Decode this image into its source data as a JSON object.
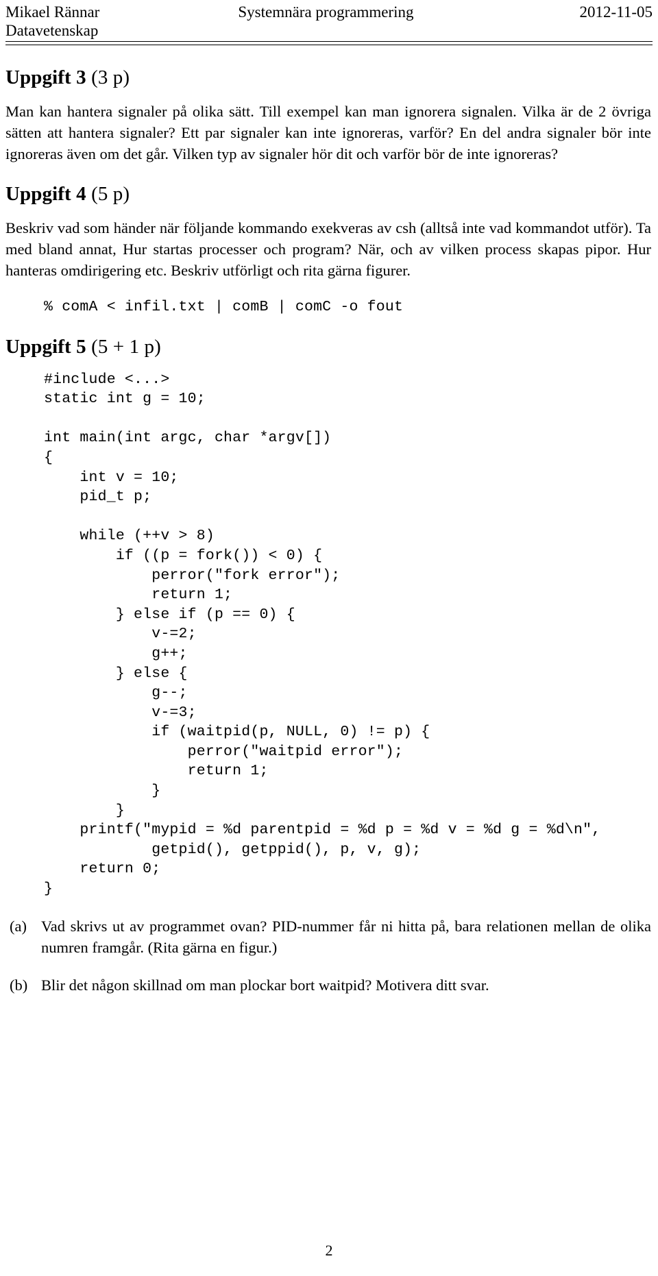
{
  "header": {
    "author": "Mikael Rännar",
    "department": "Datavetenskap",
    "course": "Systemnära programmering",
    "date": "2012-11-05"
  },
  "tasks": [
    {
      "heading_title": "Uppgift 3",
      "heading_points": "(3 p)",
      "paragraph": "Man kan hantera signaler på olika sätt. Till exempel kan man ignorera signalen. Vilka är de 2 övriga sätten att hantera signaler? Ett par signaler kan inte ignoreras, varför? En del andra signaler bör inte ignoreras även om det går. Vilken typ av signaler hör dit och varför bör de inte ignoreras?"
    },
    {
      "heading_title": "Uppgift 4",
      "heading_points": "(5 p)",
      "paragraph": "Beskriv vad som händer när följande kommando exekveras av csh (alltså inte vad kommandot utför). Ta med bland annat, Hur startas processer och program? När, och av vilken process skapas pipor. Hur hanteras omdirigering etc. Beskriv utförligt och rita gärna figurer.",
      "command": "% comA < infil.txt | comB | comC -o fout"
    },
    {
      "heading_title": "Uppgift 5",
      "heading_points": "(5 + 1 p)",
      "code": "#include <...>\nstatic int g = 10;\n\nint main(int argc, char *argv[])\n{\n    int v = 10;\n    pid_t p;\n\n    while (++v > 8)\n        if ((p = fork()) < 0) {\n            perror(\"fork error\");\n            return 1;\n        } else if (p == 0) {\n            v-=2;\n            g++;\n        } else {\n            g--;\n            v-=3;\n            if (waitpid(p, NULL, 0) != p) {\n                perror(\"waitpid error\");\n                return 1;\n            }\n        }\n    printf(\"mypid = %d parentpid = %d p = %d v = %d g = %d\\n\",\n            getpid(), getppid(), p, v, g);\n    return 0;\n}",
      "subquestions": [
        {
          "label": "(a)",
          "text": "Vad skrivs ut av programmet ovan? PID-nummer får ni hitta på, bara relationen mellan de olika numren framgår. (Rita gärna en figur.)"
        },
        {
          "label": "(b)",
          "text": "Blir det någon skillnad om man plockar bort waitpid? Motivera ditt svar."
        }
      ]
    }
  ],
  "footer": {
    "page_number": "2"
  }
}
